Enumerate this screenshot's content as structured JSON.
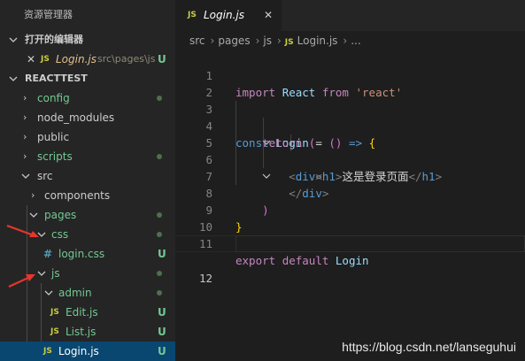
{
  "sidebar": {
    "title": "资源管理器",
    "open_editors": {
      "header": "打开的编辑器",
      "items": [
        {
          "icon": "JS",
          "close": "✕",
          "name": "Login.js",
          "path": "src\\pages\\js",
          "status": "U"
        }
      ]
    },
    "project": {
      "header": "REACTTEST",
      "rows": [
        {
          "label": "config",
          "status": "dot"
        },
        {
          "label": "node_modules",
          "status": ""
        },
        {
          "label": "public",
          "status": ""
        },
        {
          "label": "scripts",
          "status": "dot"
        },
        {
          "label": "src",
          "status": ""
        },
        {
          "label": "components",
          "status": ""
        },
        {
          "label": "pages",
          "status": "dot"
        },
        {
          "label": "css",
          "status": "dot"
        },
        {
          "icon": "#",
          "label": "login.css",
          "status": "U"
        },
        {
          "label": "js",
          "status": "dot"
        },
        {
          "label": "admin",
          "status": "dot"
        },
        {
          "icon": "JS",
          "label": "Edit.js",
          "status": "U"
        },
        {
          "icon": "JS",
          "label": "List.js",
          "status": "U"
        },
        {
          "icon": "JS",
          "label": "Login.js",
          "status": "U"
        }
      ]
    }
  },
  "editor": {
    "tab": {
      "icon": "JS",
      "name": "Login.js",
      "close": "✕"
    },
    "breadcrumb": [
      "src",
      "pages",
      "js",
      "Login.js",
      "..."
    ],
    "breadcrumb_icon": "JS",
    "line_numbers": [
      "1",
      "2",
      "3",
      "4",
      "5",
      "6",
      "7",
      "8",
      "9",
      "10",
      "11",
      "12"
    ],
    "code": {
      "l1": {
        "import": "import",
        "react_id": "React",
        "from": "from",
        "str": "'react'"
      },
      "l3": {
        "const": "const",
        "name": "Login",
        "eq": " = ",
        "open": "()",
        "arrow": " => ",
        "brace": "{"
      },
      "l4": {
        "ret": "return",
        "paren": "("
      },
      "l5": {
        "lt": "<",
        "tag": "div",
        "gt": ">"
      },
      "l6": {
        "lt": "<",
        "tag": "h1",
        "gt": ">",
        "text": "这是登录页面",
        "lt2": "</",
        "tag2": "h1",
        "gt2": ">"
      },
      "l7": {
        "lt": "</",
        "tag": "div",
        "gt": ">"
      },
      "l8": {
        "paren": ")"
      },
      "l9": {
        "brace": "}"
      },
      "l11": {
        "export": "export",
        "default": "default",
        "name": "Login"
      }
    }
  },
  "watermark": "https://blog.csdn.net/lanseguhui",
  "colors": {
    "sidebar_bg": "#252526",
    "editor_bg": "#1e1e1e",
    "selection": "#094771",
    "untracked": "#73c991",
    "js_icon": "#cbcb41",
    "arrow": "#e8352a"
  }
}
